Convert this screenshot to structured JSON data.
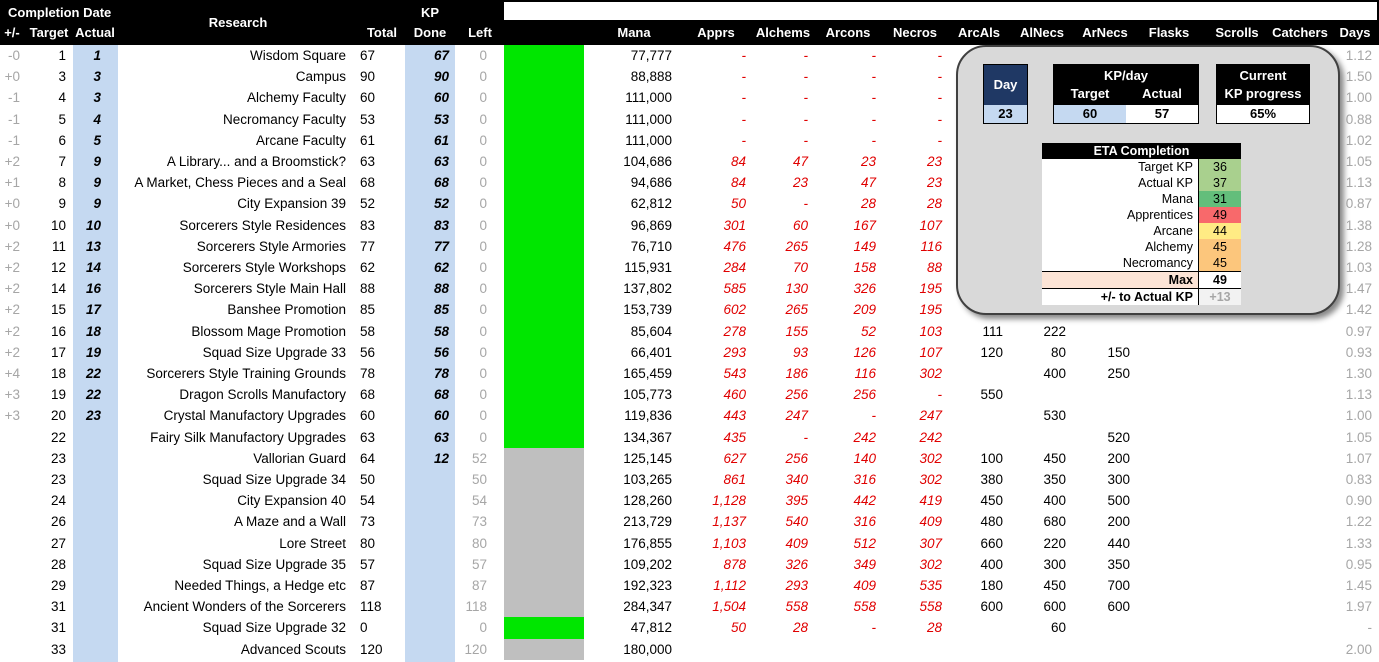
{
  "headers": {
    "completion_date": "Completion Date",
    "plus_minus": "+/-",
    "target": "Target",
    "actual": "Actual",
    "research": "Research",
    "kp": "KP",
    "total": "Total",
    "done": "Done",
    "left": "Left",
    "mana": "Mana",
    "apprs": "Apprs",
    "alchems": "Alchems",
    "arcons": "Arcons",
    "necros": "Necros",
    "arcals": "ArcAls",
    "alnecs": "AlNecs",
    "arnecs": "ArNecs",
    "flasks": "Flasks",
    "scrolls": "Scrolls",
    "catchers": "Catchers",
    "days": "Days"
  },
  "rows": [
    {
      "pm": "-0",
      "target": "1",
      "actual": "1",
      "research": "Wisdom Square",
      "total": "67",
      "done": "67",
      "left": "0",
      "bar": "green",
      "mana": "77,777",
      "apprs": "-",
      "alchems": "-",
      "arcons": "-",
      "necros": "-",
      "arcals": "",
      "alnecs": "",
      "arnecs": "",
      "days": "1.12"
    },
    {
      "pm": "+0",
      "target": "3",
      "actual": "3",
      "research": "Campus",
      "total": "90",
      "done": "90",
      "left": "0",
      "bar": "green",
      "mana": "88,888",
      "apprs": "-",
      "alchems": "-",
      "arcons": "-",
      "necros": "-",
      "arcals": "",
      "alnecs": "",
      "arnecs": "",
      "days": "1.50"
    },
    {
      "pm": "-1",
      "target": "4",
      "actual": "3",
      "research": "Alchemy Faculty",
      "total": "60",
      "done": "60",
      "left": "0",
      "bar": "green",
      "mana": "111,000",
      "apprs": "-",
      "alchems": "-",
      "arcons": "-",
      "necros": "-",
      "arcals": "",
      "alnecs": "",
      "arnecs": "",
      "days": "1.00"
    },
    {
      "pm": "-1",
      "target": "5",
      "actual": "4",
      "research": "Necromancy Faculty",
      "total": "53",
      "done": "53",
      "left": "0",
      "bar": "green",
      "mana": "111,000",
      "apprs": "-",
      "alchems": "-",
      "arcons": "-",
      "necros": "-",
      "arcals": "",
      "alnecs": "",
      "arnecs": "",
      "days": "0.88"
    },
    {
      "pm": "-1",
      "target": "6",
      "actual": "5",
      "research": "Arcane Faculty",
      "total": "61",
      "done": "61",
      "left": "0",
      "bar": "green",
      "mana": "111,000",
      "apprs": "-",
      "alchems": "-",
      "arcons": "-",
      "necros": "-",
      "arcals": "",
      "alnecs": "",
      "arnecs": "",
      "days": "1.02"
    },
    {
      "pm": "+2",
      "target": "7",
      "actual": "9",
      "research": "A Library... and a Broomstick?",
      "total": "63",
      "done": "63",
      "left": "0",
      "bar": "green",
      "mana": "104,686",
      "apprs": "84",
      "alchems": "47",
      "arcons": "23",
      "necros": "23",
      "arcals": "",
      "alnecs": "",
      "arnecs": "",
      "days": "1.05"
    },
    {
      "pm": "+1",
      "target": "8",
      "actual": "9",
      "research": "A Market, Chess Pieces and a Seal",
      "total": "68",
      "done": "68",
      "left": "0",
      "bar": "green",
      "mana": "94,686",
      "apprs": "84",
      "alchems": "23",
      "arcons": "47",
      "necros": "23",
      "arcals": "",
      "alnecs": "",
      "arnecs": "",
      "days": "1.13"
    },
    {
      "pm": "+0",
      "target": "9",
      "actual": "9",
      "research": "City Expansion 39",
      "total": "52",
      "done": "52",
      "left": "0",
      "bar": "green",
      "mana": "62,812",
      "apprs": "50",
      "alchems": "-",
      "arcons": "28",
      "necros": "28",
      "arcals": "",
      "alnecs": "",
      "arnecs": "",
      "days": "0.87"
    },
    {
      "pm": "+0",
      "target": "10",
      "actual": "10",
      "research": "Sorcerers Style Residences",
      "total": "83",
      "done": "83",
      "left": "0",
      "bar": "green",
      "mana": "96,869",
      "apprs": "301",
      "alchems": "60",
      "arcons": "167",
      "necros": "107",
      "arcals": "",
      "alnecs": "",
      "arnecs": "",
      "days": "1.38"
    },
    {
      "pm": "+2",
      "target": "11",
      "actual": "13",
      "research": "Sorcerers Style Armories",
      "total": "77",
      "done": "77",
      "left": "0",
      "bar": "green",
      "mana": "76,710",
      "apprs": "476",
      "alchems": "265",
      "arcons": "149",
      "necros": "116",
      "arcals": "",
      "alnecs": "",
      "arnecs": "",
      "days": "1.28"
    },
    {
      "pm": "+2",
      "target": "12",
      "actual": "14",
      "research": "Sorcerers Style Workshops",
      "total": "62",
      "done": "62",
      "left": "0",
      "bar": "green",
      "mana": "115,931",
      "apprs": "284",
      "alchems": "70",
      "arcons": "158",
      "necros": "88",
      "arcals": "",
      "alnecs": "",
      "arnecs": "",
      "days": "1.03"
    },
    {
      "pm": "+2",
      "target": "14",
      "actual": "16",
      "research": "Sorcerers Style Main Hall",
      "total": "88",
      "done": "88",
      "left": "0",
      "bar": "green",
      "mana": "137,802",
      "apprs": "585",
      "alchems": "130",
      "arcons": "326",
      "necros": "195",
      "arcals": "",
      "alnecs": "",
      "arnecs": "",
      "days": "1.47"
    },
    {
      "pm": "+2",
      "target": "15",
      "actual": "17",
      "research": "Banshee Promotion",
      "total": "85",
      "done": "85",
      "left": "0",
      "bar": "green",
      "mana": "153,739",
      "apprs": "602",
      "alchems": "265",
      "arcons": "209",
      "necros": "195",
      "arcals": "",
      "alnecs": "",
      "arnecs": "",
      "days": "1.42"
    },
    {
      "pm": "+2",
      "target": "16",
      "actual": "18",
      "research": "Blossom Mage Promotion",
      "total": "58",
      "done": "58",
      "left": "0",
      "bar": "green",
      "mana": "85,604",
      "apprs": "278",
      "alchems": "155",
      "arcons": "52",
      "necros": "103",
      "arcals": "111",
      "alnecs": "222",
      "arnecs": "",
      "days": "0.97"
    },
    {
      "pm": "+2",
      "target": "17",
      "actual": "19",
      "research": "Squad Size Upgrade 33",
      "total": "56",
      "done": "56",
      "left": "0",
      "bar": "green",
      "mana": "66,401",
      "apprs": "293",
      "alchems": "93",
      "arcons": "126",
      "necros": "107",
      "arcals": "120",
      "alnecs": "80",
      "arnecs": "150",
      "days": "0.93"
    },
    {
      "pm": "+4",
      "target": "18",
      "actual": "22",
      "research": "Sorcerers Style Training Grounds",
      "total": "78",
      "done": "78",
      "left": "0",
      "bar": "green",
      "mana": "165,459",
      "apprs": "543",
      "alchems": "186",
      "arcons": "116",
      "necros": "302",
      "arcals": "",
      "alnecs": "400",
      "arnecs": "250",
      "days": "1.30"
    },
    {
      "pm": "+3",
      "target": "19",
      "actual": "22",
      "research": "Dragon Scrolls Manufactory",
      "total": "68",
      "done": "68",
      "left": "0",
      "bar": "green",
      "mana": "105,773",
      "apprs": "460",
      "alchems": "256",
      "arcons": "256",
      "necros": "-",
      "arcals": "550",
      "alnecs": "",
      "arnecs": "",
      "days": "1.13"
    },
    {
      "pm": "+3",
      "target": "20",
      "actual": "23",
      "research": "Crystal Manufactory Upgrades",
      "total": "60",
      "done": "60",
      "left": "0",
      "bar": "green",
      "mana": "119,836",
      "apprs": "443",
      "alchems": "247",
      "arcons": "-",
      "necros": "247",
      "arcals": "",
      "alnecs": "530",
      "arnecs": "",
      "days": "1.00"
    },
    {
      "pm": "",
      "target": "22",
      "actual": "",
      "research": "Fairy Silk Manufactory Upgrades",
      "total": "63",
      "done": "63",
      "left": "0",
      "bar": "green",
      "mana": "134,367",
      "apprs": "435",
      "alchems": "-",
      "arcons": "242",
      "necros": "242",
      "arcals": "",
      "alnecs": "",
      "arnecs": "520",
      "days": "1.05"
    },
    {
      "pm": "",
      "target": "23",
      "actual": "",
      "research": "Vallorian Guard",
      "total": "64",
      "done": "12",
      "left": "52",
      "bar": "grey",
      "mana": "125,145",
      "apprs": "627",
      "alchems": "256",
      "arcons": "140",
      "necros": "302",
      "arcals": "100",
      "alnecs": "450",
      "arnecs": "200",
      "days": "1.07"
    },
    {
      "pm": "",
      "target": "23",
      "actual": "",
      "research": "Squad Size Upgrade 34",
      "total": "50",
      "done": "",
      "left": "50",
      "bar": "grey",
      "mana": "103,265",
      "apprs": "861",
      "alchems": "340",
      "arcons": "316",
      "necros": "302",
      "arcals": "380",
      "alnecs": "350",
      "arnecs": "300",
      "days": "0.83"
    },
    {
      "pm": "",
      "target": "24",
      "actual": "",
      "research": "City Expansion 40",
      "total": "54",
      "done": "",
      "left": "54",
      "bar": "grey",
      "mana": "128,260",
      "apprs": "1,128",
      "alchems": "395",
      "arcons": "442",
      "necros": "419",
      "arcals": "450",
      "alnecs": "400",
      "arnecs": "500",
      "days": "0.90"
    },
    {
      "pm": "",
      "target": "26",
      "actual": "",
      "research": "A Maze and a Wall",
      "total": "73",
      "done": "",
      "left": "73",
      "bar": "grey",
      "mana": "213,729",
      "apprs": "1,137",
      "alchems": "540",
      "arcons": "316",
      "necros": "409",
      "arcals": "480",
      "alnecs": "680",
      "arnecs": "200",
      "days": "1.22"
    },
    {
      "pm": "",
      "target": "27",
      "actual": "",
      "research": "Lore Street",
      "total": "80",
      "done": "",
      "left": "80",
      "bar": "grey",
      "mana": "176,855",
      "apprs": "1,103",
      "alchems": "409",
      "arcons": "512",
      "necros": "307",
      "arcals": "660",
      "alnecs": "220",
      "arnecs": "440",
      "days": "1.33"
    },
    {
      "pm": "",
      "target": "28",
      "actual": "",
      "research": "Squad Size Upgrade 35",
      "total": "57",
      "done": "",
      "left": "57",
      "bar": "grey",
      "mana": "109,202",
      "apprs": "878",
      "alchems": "326",
      "arcons": "349",
      "necros": "302",
      "arcals": "400",
      "alnecs": "300",
      "arnecs": "350",
      "days": "0.95"
    },
    {
      "pm": "",
      "target": "29",
      "actual": "",
      "research": "Needed Things, a Hedge etc",
      "total": "87",
      "done": "",
      "left": "87",
      "bar": "grey",
      "mana": "192,323",
      "apprs": "1,112",
      "alchems": "293",
      "arcons": "409",
      "necros": "535",
      "arcals": "180",
      "alnecs": "450",
      "arnecs": "700",
      "days": "1.45"
    },
    {
      "pm": "",
      "target": "31",
      "actual": "",
      "research": "Ancient Wonders of the Sorcerers",
      "total": "118",
      "done": "",
      "left": "118",
      "bar": "grey",
      "mana": "284,347",
      "apprs": "1,504",
      "alchems": "558",
      "arcons": "558",
      "necros": "558",
      "arcals": "600",
      "alnecs": "600",
      "arnecs": "600",
      "days": "1.97"
    },
    {
      "pm": "",
      "target": "31",
      "actual": "",
      "research": "Squad Size Upgrade 32",
      "total": "0",
      "done": "",
      "left": "0",
      "bar": "green",
      "mana": "47,812",
      "apprs": "50",
      "alchems": "28",
      "arcons": "-",
      "necros": "28",
      "arcals": "",
      "alnecs": "60",
      "arnecs": "",
      "days": "-"
    },
    {
      "pm": "",
      "target": "33",
      "actual": "",
      "research": "Advanced Scouts",
      "total": "120",
      "done": "",
      "left": "120",
      "bar": "grey",
      "mana": "180,000",
      "apprs": "",
      "alchems": "",
      "arcons": "",
      "necros": "",
      "arcals": "",
      "alnecs": "",
      "arnecs": "",
      "days": "2.00"
    }
  ],
  "panel": {
    "day_label": "Day",
    "day_value": "23",
    "kp_per_day_label": "KP/day",
    "target_label": "Target",
    "actual_label": "Actual",
    "target_value": "60",
    "actual_value": "57",
    "current_label_1": "Current",
    "current_label_2": "KP progress",
    "current_value": "65%",
    "eta_title": "ETA Completion",
    "eta_rows": [
      {
        "label": "Target KP",
        "value": "36",
        "color": "#a9d08e"
      },
      {
        "label": "Actual KP",
        "value": "37",
        "color": "#a9d08e"
      },
      {
        "label": "Mana",
        "value": "31",
        "color": "#63be7b"
      },
      {
        "label": "Apprentices",
        "value": "49",
        "color": "#f8696b"
      },
      {
        "label": "Arcane",
        "value": "44",
        "color": "#ffeb84"
      },
      {
        "label": "Alchemy",
        "value": "45",
        "color": "#fcc67c"
      },
      {
        "label": "Necromancy",
        "value": "45",
        "color": "#fcc67c"
      }
    ],
    "max_label": "Max",
    "max_value": "49",
    "diff_label": "+/- to Actual KP",
    "diff_value": "+13"
  }
}
